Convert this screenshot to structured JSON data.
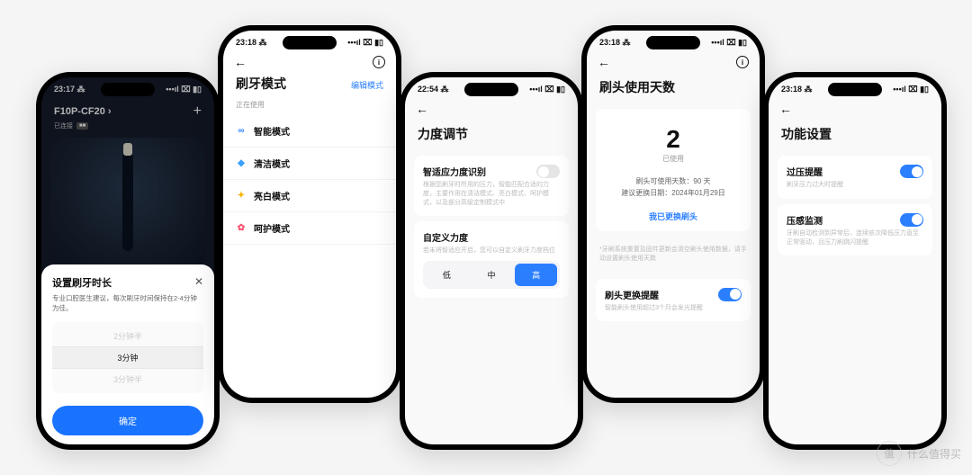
{
  "status": {
    "time1": "23:17 ⁂",
    "time2": "23:18 ⁂",
    "time3": "23:18 ⁂",
    "time4": "22:54 ⁂",
    "right": "•••ıl ⌧ ▮▯"
  },
  "phone1": {
    "device_name": "F10P-CF20 ›",
    "connected": "已连接",
    "battery_badge": "■■",
    "sheet": {
      "title": "设置刷牙时长",
      "desc": "专业口腔医生建议，每次刷牙时间保持在2-4分钟为佳。",
      "options": [
        "2分钟半",
        "3分钟",
        "3分钟半"
      ],
      "selected_index": 1,
      "confirm": "确定"
    }
  },
  "phone2": {
    "title": "刷牙模式",
    "edit": "编辑模式",
    "section": "正在使用",
    "modes": [
      {
        "icon": "∞",
        "color": "#2b7fff",
        "label": "智能模式"
      },
      {
        "icon": "◇",
        "color": "#3aa0ff",
        "label": "清洁模式"
      },
      {
        "icon": "✦",
        "color": "#f5b400",
        "label": "亮白模式"
      },
      {
        "icon": "❀",
        "color": "#ff4d6d",
        "label": "呵护模式"
      }
    ]
  },
  "phone3": {
    "title": "力度调节",
    "smart": {
      "title": "智适应力度识别",
      "desc": "根据您刷牙时所用的压力，智能匹配合适的力度，主要作用在清洁模式、亮白模式、呵护模式，以及部分高级定制模式中"
    },
    "custom": {
      "title": "自定义力度",
      "desc": "若未将智适应开启，您可以自定义刷牙力度档位",
      "options": [
        "低",
        "中",
        "高"
      ],
      "selected_index": 2
    }
  },
  "phone4": {
    "title": "刷头使用天数",
    "days": "2",
    "days_label": "已使用",
    "line1": "刷头可使用天数：90 天",
    "line2": "建议更换日期：2024年01月29日",
    "replaced_link": "我已更换刷头",
    "note": "*牙刷系统重置及固件更新会清空刷头使用数据，请手动设置刷头使用天数",
    "reminder_title": "刷头更换提醒",
    "reminder_desc": "智能刷头使用超过3个月会发光提醒"
  },
  "phone5": {
    "title": "功能设置",
    "over_pressure": {
      "title": "过压提醒",
      "desc": "刷牙压力过大时提醒"
    },
    "pressure_sense": {
      "title": "压感监测",
      "desc": "牙刷自动检测到异常后，连续依次降低压力直至正常驱动，且压力刷跳闪提醒"
    }
  },
  "watermark": "什么值得买"
}
